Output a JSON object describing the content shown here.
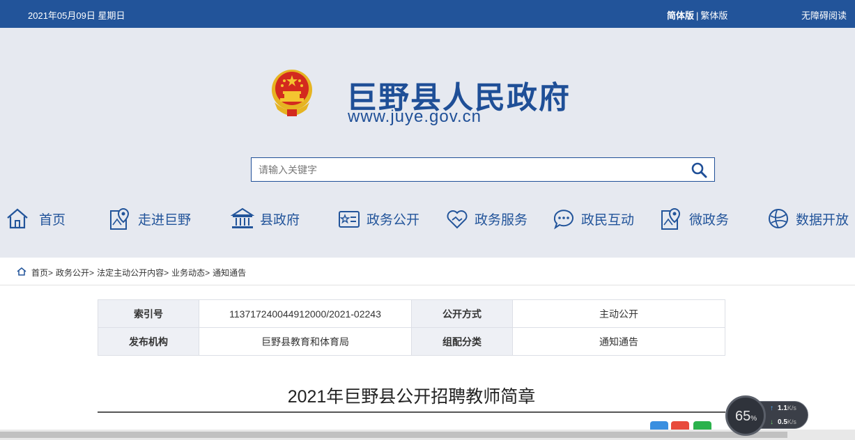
{
  "topbar": {
    "date": "2021年05月09日 星期日",
    "lang_simplified": "简体版",
    "lang_separator": "|",
    "lang_traditional": "繁体版",
    "accessibility": "无障碍阅读"
  },
  "header": {
    "site_title": "巨野县人民政府",
    "site_url": "www.juye.gov.cn",
    "search_placeholder": "请输入关键字",
    "brand_color": "#1f4f97"
  },
  "nav": [
    {
      "label": "首页",
      "icon": "home-icon"
    },
    {
      "label": "走进巨野",
      "icon": "map-pin-icon"
    },
    {
      "label": "县政府",
      "icon": "government-building-icon"
    },
    {
      "label": "政务公开",
      "icon": "id-card-icon"
    },
    {
      "label": "政务服务",
      "icon": "handshake-heart-icon"
    },
    {
      "label": "政民互动",
      "icon": "chat-bubble-icon"
    },
    {
      "label": "微政务",
      "icon": "map-pin-icon"
    },
    {
      "label": "数据开放",
      "icon": "globe-icon"
    }
  ],
  "breadcrumb": {
    "items": [
      "首页",
      "政务公开",
      "法定主动公开内容",
      "业务动态",
      "通知通告"
    ],
    "separator": ">"
  },
  "info_table": {
    "rows": [
      {
        "k1": "索引号",
        "v1": "113717240044912000/2021-02243",
        "k2": "公开方式",
        "v2": "主动公开"
      },
      {
        "k1": "发布机构",
        "v1": "巨野县教育和体育局",
        "k2": "组配分类",
        "v2": "通知通告"
      }
    ]
  },
  "article": {
    "title": "2021年巨野县公开招聘教师简章"
  },
  "netmon": {
    "percent": "65",
    "percent_unit": "%",
    "up_speed": "1.1",
    "down_speed": "0.5",
    "speed_unit": "K/s",
    "up_arrow": "↑",
    "down_arrow": "↓"
  }
}
